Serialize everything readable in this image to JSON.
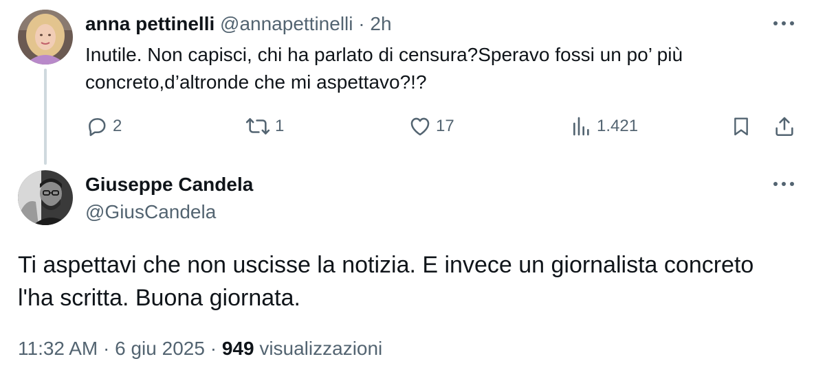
{
  "reply": {
    "author_name": "anna pettinelli",
    "handle": "@annapettinelli",
    "separator": "·",
    "time": "2h",
    "text": "Inutile. Non capisci, chi ha parlato di censura?Speravo fossi un po’ più concreto,d’altronde che mi aspettavo?!?",
    "actions": {
      "replies": "2",
      "reposts": "1",
      "likes": "17",
      "views": "1.421"
    },
    "icons": [
      "reply-icon",
      "repost-icon",
      "like-icon",
      "views-icon",
      "bookmark-icon",
      "share-icon",
      "more-icon"
    ]
  },
  "main": {
    "author_name": "Giuseppe Candela",
    "handle": "@GiusCandela",
    "text": "Ti aspettavi che non uscisse la notizia. E invece un giornalista concreto l'ha scritta. Buona giornata.",
    "meta": {
      "time": "11:32 AM",
      "separator": "·",
      "date": "6 giu 2025",
      "views_count": "949",
      "views_label": "visualizzazioni"
    }
  },
  "colors": {
    "text": "#0f1419",
    "muted": "#536471",
    "thread_line": "#cfd9de"
  }
}
